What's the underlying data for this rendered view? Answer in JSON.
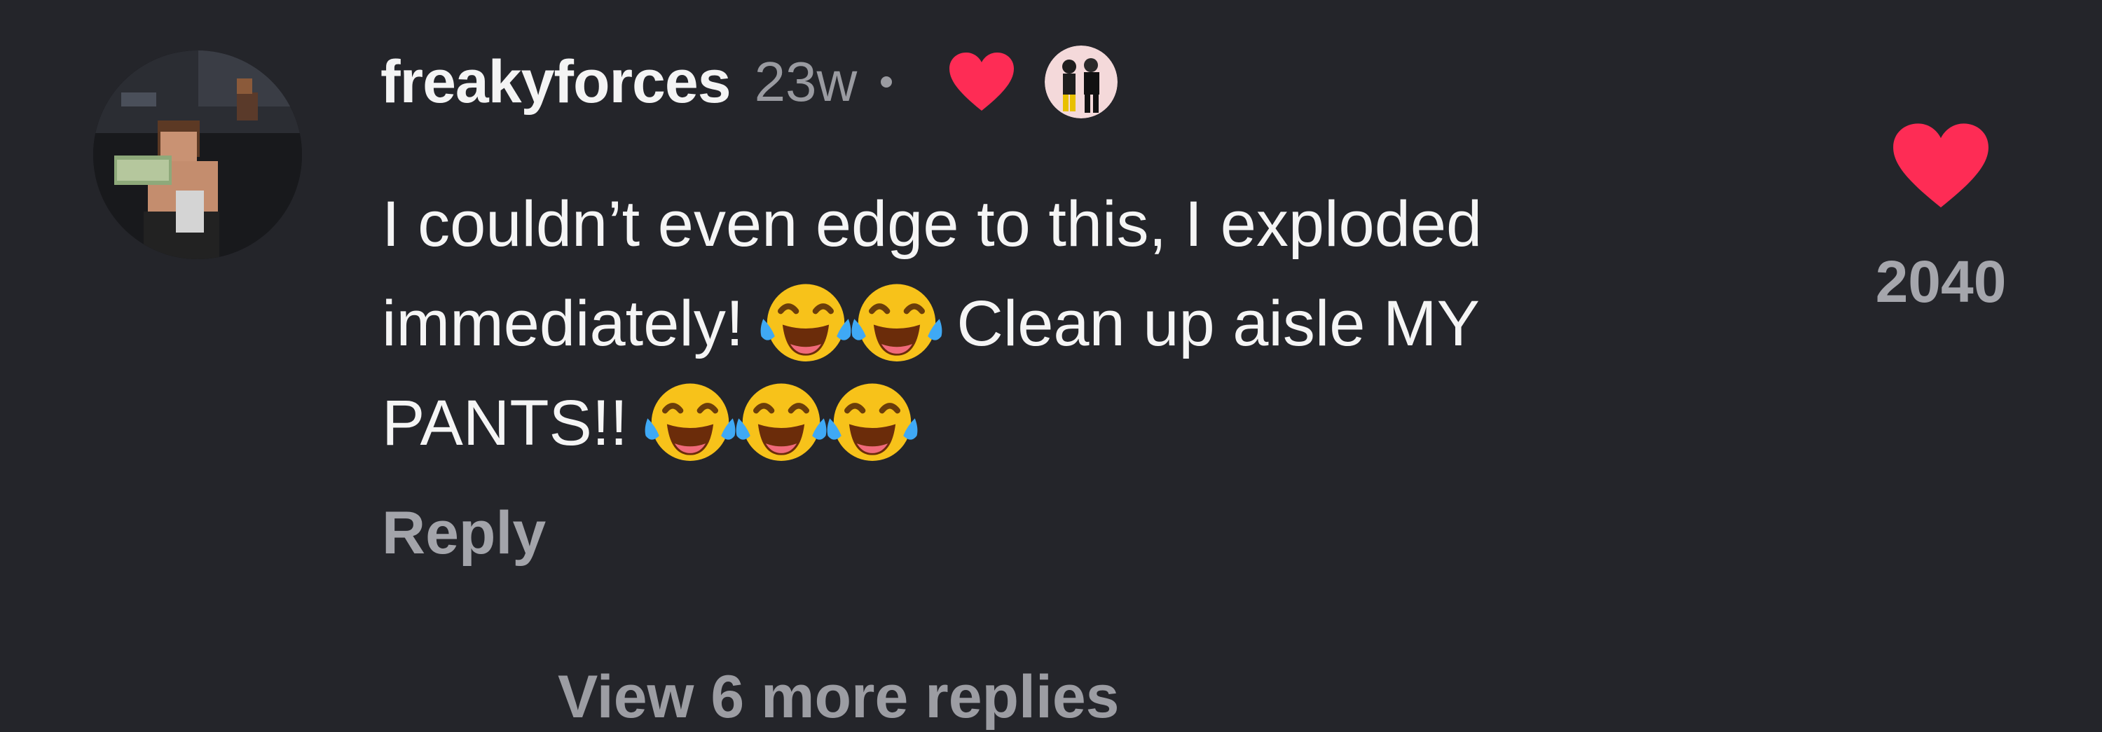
{
  "comment": {
    "username": "freakyforces",
    "time_ago": "23w",
    "text_line_1": "I couldn’t even edge to this, I exploded",
    "text_line_2a": "immediately!",
    "text_line_2b": "Clean up aisle MY",
    "text_line_3": "PANTS!!",
    "reply_label": "Reply",
    "like_count": "2040",
    "view_more_replies": "View 6 more replies"
  },
  "icons": {
    "avatar": "roblox-avatar",
    "creator_like": "heart-icon",
    "creator_avatar": "creator-avatar",
    "emoji": "face-with-tears-of-joy",
    "like": "heart-icon"
  },
  "colors": {
    "background": "#24252a",
    "heart": "#fe2c55",
    "secondary_text": "#a3a4aa"
  }
}
